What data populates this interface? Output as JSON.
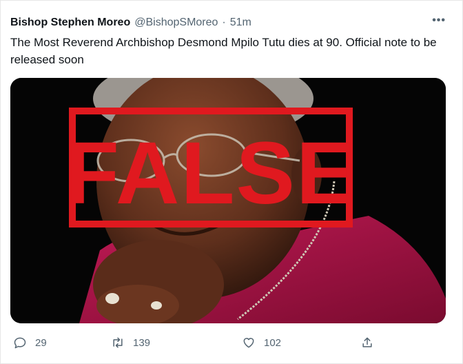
{
  "tweet": {
    "author_name": "Bishop Stephen Moreo",
    "handle": "@BishopSMoreo",
    "separator": "·",
    "time": "51m",
    "more": "•••",
    "text": "The Most Reverend Archbishop Desmond Mpilo Tutu dies at 90. Official note to be released soon"
  },
  "media": {
    "stamp_text": "FALSE",
    "stamp_color": "#e0191f",
    "description_icon": "photo"
  },
  "actions": {
    "replies": "29",
    "retweets": "139",
    "likes": "102"
  },
  "icons": {
    "reply": "reply-icon",
    "retweet": "retweet-icon",
    "like": "like-icon",
    "share": "share-icon",
    "more": "more-icon"
  },
  "colors": {
    "text": "#0f1419",
    "secondary": "#536471",
    "robe": "#b3124a",
    "stamp": "#e0191f"
  }
}
